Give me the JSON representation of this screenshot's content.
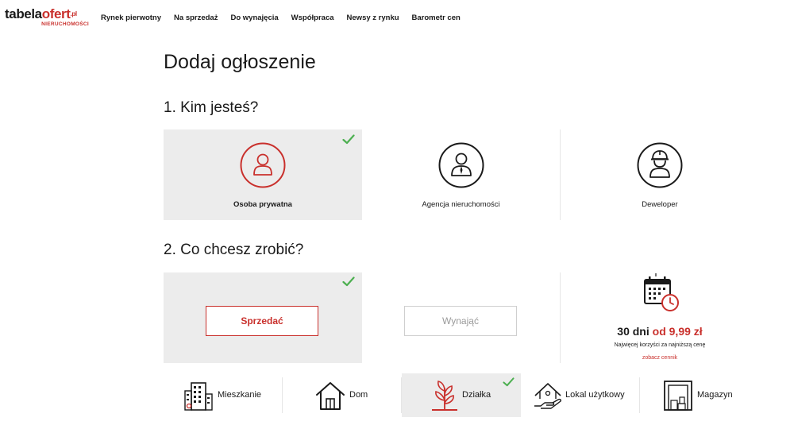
{
  "header": {
    "logo": {
      "part1": "tabela",
      "part2": "ofert",
      "suffix": ".pl",
      "subtitle": "NIERUCHOMOŚCI"
    },
    "nav": [
      {
        "label": "Rynek pierwotny"
      },
      {
        "label": "Na sprzedaż"
      },
      {
        "label": "Do wynajęcia"
      },
      {
        "label": "Współpraca"
      },
      {
        "label": "Newsy z rynku"
      },
      {
        "label": "Barometr cen"
      }
    ]
  },
  "page": {
    "title": "Dodaj ogłoszenie"
  },
  "who": {
    "title": "1. Kim jesteś?",
    "options": [
      {
        "label": "Osoba prywatna",
        "icon": "person-icon",
        "selected": true
      },
      {
        "label": "Agencja nieruchomości",
        "icon": "agent-icon",
        "selected": false
      },
      {
        "label": "Deweloper",
        "icon": "builder-icon",
        "selected": false
      }
    ]
  },
  "action": {
    "title": "2. Co chcesz zrobić?",
    "sell_label": "Sprzedać",
    "rent_label": "Wynająć",
    "selected": "sell"
  },
  "promo": {
    "icon": "calendar-clock-icon",
    "price_prefix": "30 dni",
    "price_value": "od 9,99 zł",
    "note": "Najwięcej korzyści za najniższą cenę",
    "link": "zobacz cennik"
  },
  "property_types": [
    {
      "label": "Mieszkanie",
      "icon": "apartment-building-icon",
      "selected": false
    },
    {
      "label": "Dom",
      "icon": "house-icon",
      "selected": false
    },
    {
      "label": "Działka",
      "icon": "plant-icon",
      "selected": true
    },
    {
      "label": "Lokal użytkowy",
      "icon": "hand-house-icon",
      "selected": false
    },
    {
      "label": "Magazyn",
      "icon": "warehouse-icon",
      "selected": false
    }
  ],
  "colors": {
    "accent": "#c9302c",
    "check": "#4caf50",
    "selected_bg": "#ececec",
    "text": "#1a1a1a"
  }
}
